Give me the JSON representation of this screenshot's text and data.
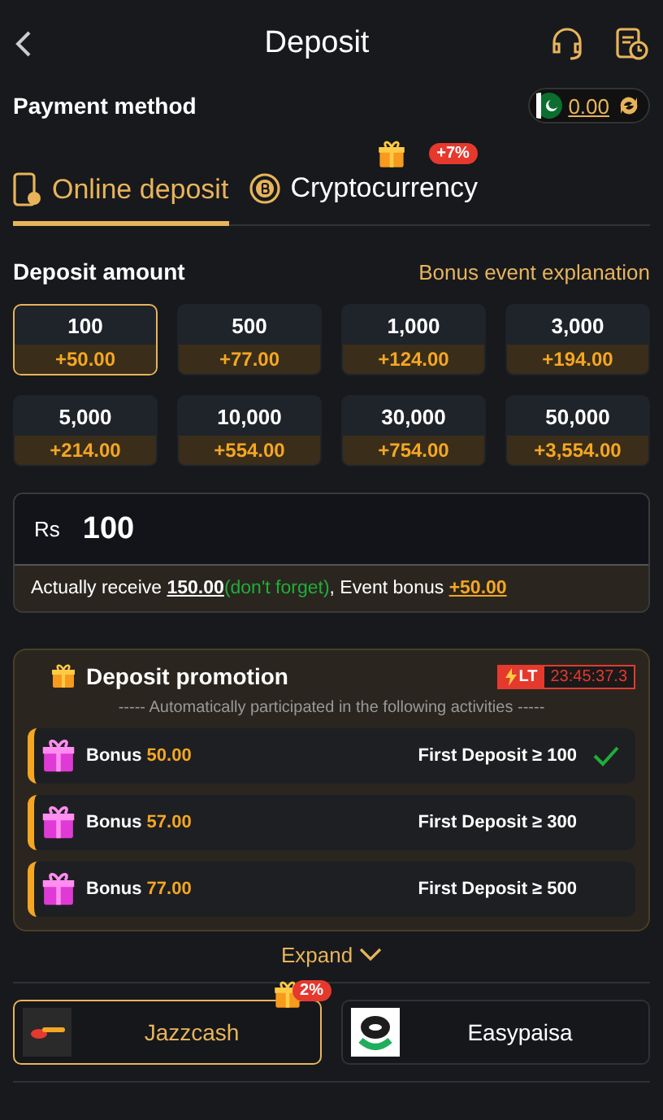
{
  "header": {
    "title": "Deposit"
  },
  "payment_method": {
    "label": "Payment method",
    "balance": "0.00"
  },
  "tabs": [
    {
      "label": "Online deposit",
      "selected": true,
      "kind": "phone"
    },
    {
      "label": "Cryptocurrency",
      "selected": false,
      "kind": "coin",
      "badge": "+7%"
    }
  ],
  "deposit_amount": {
    "title": "Deposit amount",
    "link": "Bonus event explanation"
  },
  "amounts": [
    {
      "amount": "100",
      "bonus": "+50.00",
      "selected": true
    },
    {
      "amount": "500",
      "bonus": "+77.00",
      "selected": false
    },
    {
      "amount": "1,000",
      "bonus": "+124.00",
      "selected": false
    },
    {
      "amount": "3,000",
      "bonus": "+194.00",
      "selected": false
    },
    {
      "amount": "5,000",
      "bonus": "+214.00",
      "selected": false
    },
    {
      "amount": "10,000",
      "bonus": "+554.00",
      "selected": false
    },
    {
      "amount": "30,000",
      "bonus": "+754.00",
      "selected": false
    },
    {
      "amount": "50,000",
      "bonus": "+3,554.00",
      "selected": false
    }
  ],
  "amount_field": {
    "currency": "Rs",
    "value": "100"
  },
  "receive": {
    "label": "Actually receive",
    "total": "150.00",
    "note": "(don't forget)",
    "bonus_label": ", Event bonus",
    "bonus": "+50.00"
  },
  "promotion": {
    "title": "Deposit promotion",
    "timer_tag": "LT",
    "timer": "23:45:37.3",
    "subtitle": "----- Automatically participated in the following activities -----",
    "items": [
      {
        "label": "Bonus",
        "amount": "50.00",
        "condition": "First Deposit ≥ 100",
        "done": true
      },
      {
        "label": "Bonus",
        "amount": "57.00",
        "condition": "First Deposit ≥ 300",
        "done": false
      },
      {
        "label": "Bonus",
        "amount": "77.00",
        "condition": "First Deposit ≥ 500",
        "done": false
      }
    ]
  },
  "expand": "Expand",
  "methods": [
    {
      "name": "Jazzcash",
      "selected": true,
      "kind": "jazzcash",
      "badge": "2%"
    },
    {
      "name": "Easypaisa",
      "selected": false,
      "kind": "easypaisa"
    }
  ]
}
